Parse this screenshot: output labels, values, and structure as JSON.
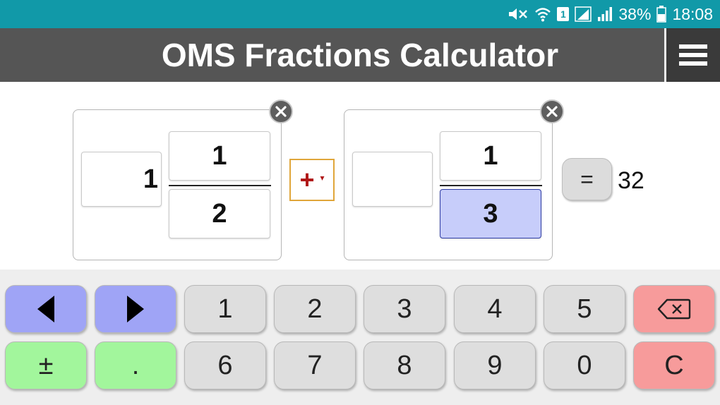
{
  "status_bar": {
    "battery_percent": "38%",
    "time": "18:08",
    "sim_number": "1",
    "icons": [
      "mute-icon",
      "wifi-icon",
      "sim-icon",
      "signal-icon",
      "signal-icon-2",
      "battery-icon"
    ]
  },
  "header": {
    "title": "OMS Fractions Calculator",
    "menu_icon": "hamburger-menu-icon"
  },
  "operand_a": {
    "whole": "1",
    "numerator": "1",
    "denominator": "2",
    "clear_icon": "close-circle-icon"
  },
  "operator": {
    "symbol": "+",
    "caret": "▾"
  },
  "operand_b": {
    "whole": "",
    "numerator": "1",
    "denominator": "3",
    "active_field": "denominator",
    "clear_icon": "close-circle-icon"
  },
  "equals": {
    "label": "="
  },
  "result": {
    "value": "32"
  },
  "keypad": {
    "row1": [
      "◀",
      "▶",
      "1",
      "2",
      "3",
      "4",
      "5",
      "⌫"
    ],
    "row2": [
      "±",
      ".",
      "6",
      "7",
      "8",
      "9",
      "0",
      "C"
    ],
    "labels": {
      "plusminus": "±",
      "decimal": ".",
      "clear": "C",
      "k1": "1",
      "k2": "2",
      "k3": "3",
      "k4": "4",
      "k5": "5",
      "k6": "6",
      "k7": "7",
      "k8": "8",
      "k9": "9",
      "k0": "0"
    }
  },
  "colors": {
    "status_bar": "#1199a8",
    "title_bar": "#555555",
    "nav_key": "#9fa4f6",
    "green_key": "#a2f69c",
    "red_key": "#f79b9b",
    "digit_key": "#dedede",
    "active_field": "#c7cdfa",
    "operator_red": "#b01818"
  }
}
